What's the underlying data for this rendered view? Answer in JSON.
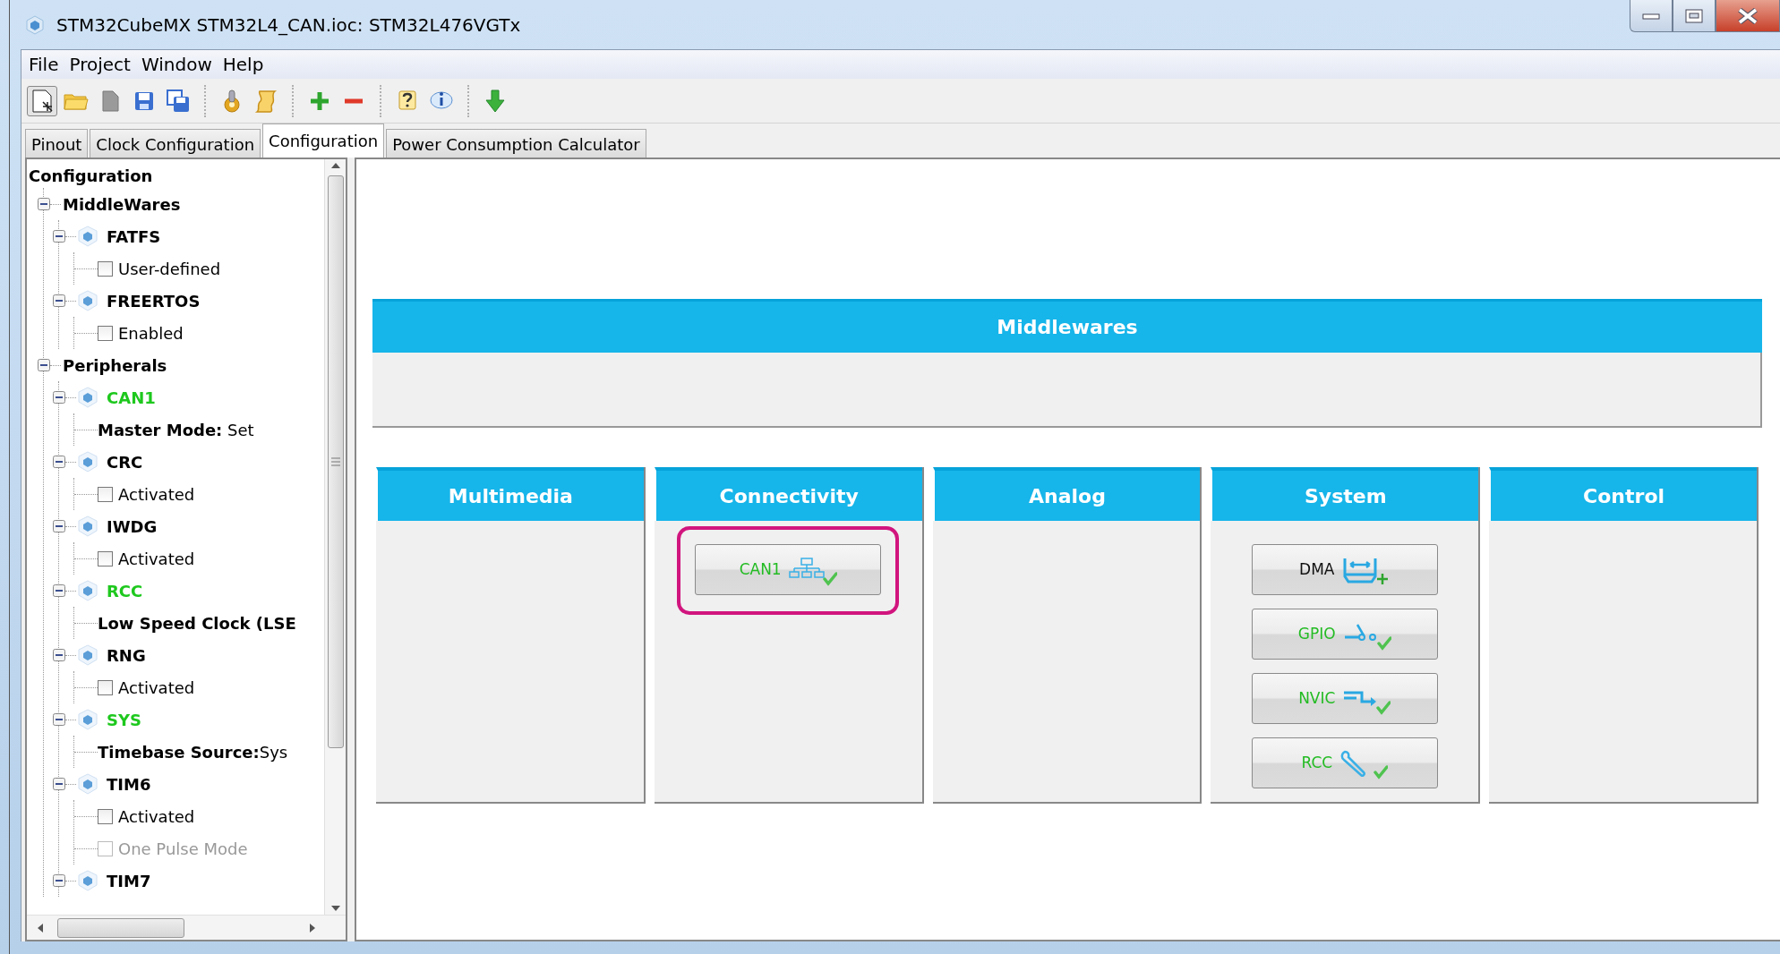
{
  "window": {
    "title": "STM32CubeMX STM32L4_CAN.ioc: STM32L476VGTx"
  },
  "menu": [
    "File",
    "Project",
    "Window",
    "Help"
  ],
  "tabs": [
    {
      "label": "Pinout",
      "selected": false
    },
    {
      "label": "Clock Configuration",
      "selected": false
    },
    {
      "label": "Configuration",
      "selected": true
    },
    {
      "label": "Power Consumption Calculator",
      "selected": false
    }
  ],
  "tree": {
    "label": "Configuration",
    "children": [
      {
        "kind": "group",
        "label": "MiddleWares",
        "expanded": true,
        "children": [
          {
            "kind": "module",
            "label": "FATFS",
            "color": "#000000",
            "expanded": true,
            "children": [
              {
                "kind": "checkbox",
                "label": "User-defined",
                "checked": false,
                "disabled": false
              }
            ]
          },
          {
            "kind": "module",
            "label": "FREERTOS",
            "color": "#000000",
            "expanded": true,
            "children": [
              {
                "kind": "checkbox",
                "label": "Enabled",
                "checked": false,
                "disabled": false
              }
            ]
          }
        ]
      },
      {
        "kind": "group",
        "label": "Peripherals",
        "expanded": true,
        "children": [
          {
            "kind": "module",
            "label": "CAN1",
            "color": "#1ec81e",
            "expanded": true,
            "children": [
              {
                "kind": "setting",
                "label": "**Master Mode:** Set"
              }
            ]
          },
          {
            "kind": "module",
            "label": "CRC",
            "color": "#000000",
            "expanded": true,
            "children": [
              {
                "kind": "checkbox",
                "label": "Activated",
                "checked": false,
                "disabled": false
              }
            ]
          },
          {
            "kind": "module",
            "label": "IWDG",
            "color": "#000000",
            "expanded": true,
            "children": [
              {
                "kind": "checkbox",
                "label": "Activated",
                "checked": false,
                "disabled": false
              }
            ]
          },
          {
            "kind": "module",
            "label": "RCC",
            "color": "#1ec81e",
            "expanded": true,
            "children": [
              {
                "kind": "setting",
                "label": "**Low Speed Clock (LSE**"
              }
            ]
          },
          {
            "kind": "module",
            "label": "RNG",
            "color": "#000000",
            "expanded": true,
            "children": [
              {
                "kind": "checkbox",
                "label": "Activated",
                "checked": false,
                "disabled": false
              }
            ]
          },
          {
            "kind": "module",
            "label": "SYS",
            "color": "#1ec81e",
            "expanded": true,
            "children": [
              {
                "kind": "setting",
                "label": "**Timebase Source:**Sys"
              }
            ]
          },
          {
            "kind": "module",
            "label": "TIM6",
            "color": "#000000",
            "expanded": true,
            "children": [
              {
                "kind": "checkbox",
                "label": "Activated",
                "checked": false,
                "disabled": false
              },
              {
                "kind": "checkbox",
                "label": "One Pulse Mode",
                "checked": false,
                "disabled": true
              }
            ]
          },
          {
            "kind": "module",
            "label": "TIM7",
            "color": "#000000",
            "expanded": true
          }
        ]
      }
    ]
  },
  "middlewares": {
    "title": "Middlewares"
  },
  "categories": [
    {
      "title": "Multimedia"
    },
    {
      "title": "Connectivity",
      "buttons": [
        {
          "label": "CAN1",
          "kind": "network",
          "configured": true,
          "highlighted": true
        }
      ]
    },
    {
      "title": "Analog"
    },
    {
      "title": "System",
      "buttons": [
        {
          "label": "DMA",
          "kind": "dma",
          "configured": false,
          "highlighted": false
        },
        {
          "label": "GPIO",
          "kind": "gpio",
          "configured": true,
          "highlighted": false
        },
        {
          "label": "NVIC",
          "kind": "nvic",
          "configured": true,
          "highlighted": false
        },
        {
          "label": "RCC",
          "kind": "wrench",
          "configured": true,
          "highlighted": false
        }
      ]
    },
    {
      "title": "Control"
    }
  ]
}
